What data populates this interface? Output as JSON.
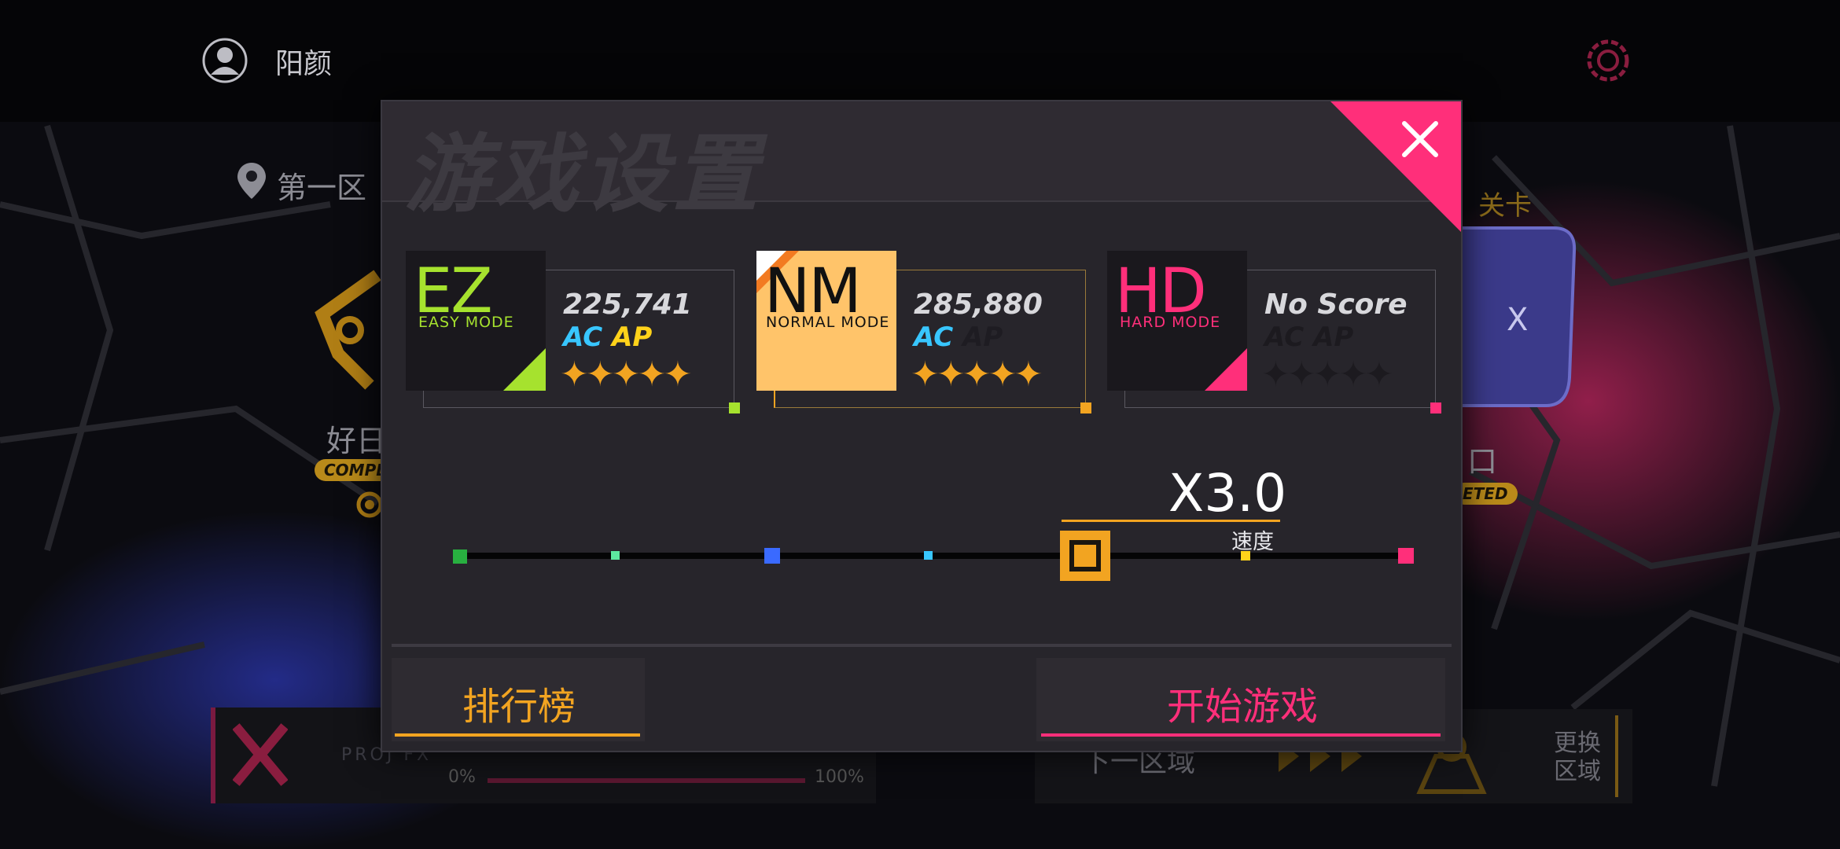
{
  "header": {
    "username": "阳颜",
    "avatar_icon": "user-icon",
    "settings_icon": "gear-icon",
    "accent": "#ff2f7a"
  },
  "background": {
    "region_label": "第一区",
    "left_node_label": "好日",
    "left_node_badge": "COMPL",
    "right_node_label": "口",
    "right_node_badge": "ETED",
    "right_top_label": "关卡",
    "logo_text": "PROJ FX",
    "progress_min": "0%",
    "progress_max": "100%",
    "next_region": "下一区域",
    "change_region": "更换\n区域"
  },
  "modal": {
    "title": "游戏设置",
    "close_icon": "close-icon",
    "difficulties": [
      {
        "abbr": "EZ",
        "mode": "EASY MODE",
        "score": "225,741",
        "ac": "AC",
        "ap": "AP",
        "stars_filled": 5,
        "stars_total": 5,
        "color": "#a6e22e"
      },
      {
        "abbr": "NM",
        "mode": "NORMAL MODE",
        "score": "285,880",
        "ac": "AC",
        "ap": "AP",
        "stars_filled": 5,
        "stars_total": 5,
        "color": "#f2a421",
        "selected": true
      },
      {
        "abbr": "HD",
        "mode": "HARD MODE",
        "score": "No Score",
        "ac": "AC",
        "ap": "AP",
        "stars_filled": 0,
        "stars_total": 5,
        "color": "#ff2f7a"
      }
    ],
    "speed": {
      "value": "X3.0",
      "label": "速度"
    },
    "leaderboard_label": "排行榜",
    "start_label": "开始游戏",
    "colors": {
      "leaderboard": "#f2a421",
      "start": "#ff2f7a"
    }
  }
}
